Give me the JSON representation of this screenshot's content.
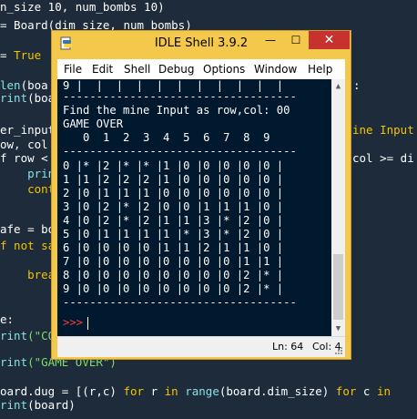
{
  "background_code": {
    "lines": [
      {
        "pre": "",
        "parts": [
          {
            "t": "n_size 10, num_bombs 10)",
            "c": ""
          }
        ]
      },
      {
        "pre": "",
        "parts": [
          {
            "t": "= Board(dim_size, num_bombs)",
            "c": ""
          }
        ]
      },
      {
        "pre": "",
        "parts": [
          {
            "t": "= ",
            "c": ""
          },
          {
            "t": "True",
            "c": "kw"
          }
        ]
      },
      {
        "pre": "",
        "parts": [
          {
            "t": "len",
            "c": "fn"
          },
          {
            "t": "(boa",
            "c": ""
          }
        ]
      },
      {
        "pre": "",
        "parts": [
          {
            "t": "rint",
            "c": "fn"
          },
          {
            "t": "(boa",
            "c": ""
          }
        ]
      },
      {
        "pre": "",
        "parts": [
          {
            "t": "er_input",
            "c": ""
          }
        ]
      },
      {
        "pre": "",
        "parts": [
          {
            "t": "ow, col",
            "c": ""
          }
        ]
      },
      {
        "pre": "",
        "parts": [
          {
            "t": "f row <",
            "c": ""
          }
        ]
      },
      {
        "pre": "",
        "parts": [
          {
            "t": "    print",
            "c": "fn"
          }
        ]
      },
      {
        "pre": "",
        "parts": [
          {
            "t": "    conti",
            "c": "kw"
          }
        ]
      },
      {
        "pre": "",
        "parts": [
          {
            "t": "afe = bo",
            "c": ""
          }
        ]
      },
      {
        "pre": "",
        "parts": [
          {
            "t": "f not sa",
            "c": "kw"
          }
        ]
      },
      {
        "pre": "",
        "parts": [
          {
            "t": "    break",
            "c": "kw"
          }
        ]
      },
      {
        "pre": "",
        "parts": [
          {
            "t": "e:",
            "c": ""
          }
        ]
      },
      {
        "pre": "",
        "parts": [
          {
            "t": "rint",
            "c": "fn"
          },
          {
            "t": "(\"CO",
            "c": "str"
          }
        ]
      },
      {
        "pre": "",
        "parts": [
          {
            "t": "rint",
            "c": "fn"
          },
          {
            "t": "(\"GAME OVER\")",
            "c": "str"
          }
        ]
      },
      {
        "pre": "",
        "parts": [
          {
            "t": "oard.dug = [(r,c) ",
            "c": ""
          },
          {
            "t": "for",
            "c": "kw"
          },
          {
            "t": " r ",
            "c": ""
          },
          {
            "t": "in",
            "c": "kw"
          },
          {
            "t": " ",
            "c": ""
          },
          {
            "t": "range",
            "c": "fn"
          },
          {
            "t": "(board.dim_size) ",
            "c": ""
          },
          {
            "t": "for",
            "c": "kw"
          },
          {
            "t": " c ",
            "c": ""
          },
          {
            "t": "in",
            "c": "kw"
          }
        ]
      },
      {
        "pre": "",
        "parts": [
          {
            "t": "rint",
            "c": "fn"
          },
          {
            "t": "(board)",
            "c": ""
          }
        ]
      }
    ],
    "right_fragments": [
      "ine Input",
      "col >= di",
      ":"
    ]
  },
  "window": {
    "title": "IDLE Shell 3.9.2",
    "min_label": "—",
    "max_label": "☐",
    "close_label": "✕"
  },
  "menu": [
    "File",
    "Edit",
    "Shell",
    "Debug",
    "Options",
    "Window",
    "Help"
  ],
  "shell": {
    "lines": [
      "9 |  |  |  |  |  |  |  |  |  |  |",
      "-----------------------------------",
      "Find the mine Input as row,col: 00",
      "GAME OVER",
      "   0  1  2  3  4  5  6  7  8  9",
      "-----------------------------------",
      "0 |* |2 |* |* |1 |0 |0 |0 |0 |0 |",
      "1 |1 |2 |2 |2 |1 |0 |0 |0 |0 |0 |",
      "2 |0 |1 |1 |1 |0 |0 |0 |0 |0 |0 |",
      "3 |0 |2 |* |2 |0 |0 |1 |1 |1 |0 |",
      "4 |0 |2 |* |2 |1 |1 |3 |* |2 |0 |",
      "5 |0 |1 |1 |1 |1 |* |3 |* |2 |0 |",
      "6 |0 |0 |0 |0 |1 |1 |2 |1 |1 |0 |",
      "7 |0 |0 |0 |0 |0 |0 |0 |0 |1 |1 |",
      "8 |0 |0 |0 |0 |0 |0 |0 |0 |2 |* |",
      "9 |0 |0 |0 |0 |0 |0 |0 |0 |2 |* |",
      "-----------------------------------"
    ],
    "prompt": ">>>"
  },
  "status": {
    "line": "Ln: 64",
    "col": "Col: 4"
  }
}
